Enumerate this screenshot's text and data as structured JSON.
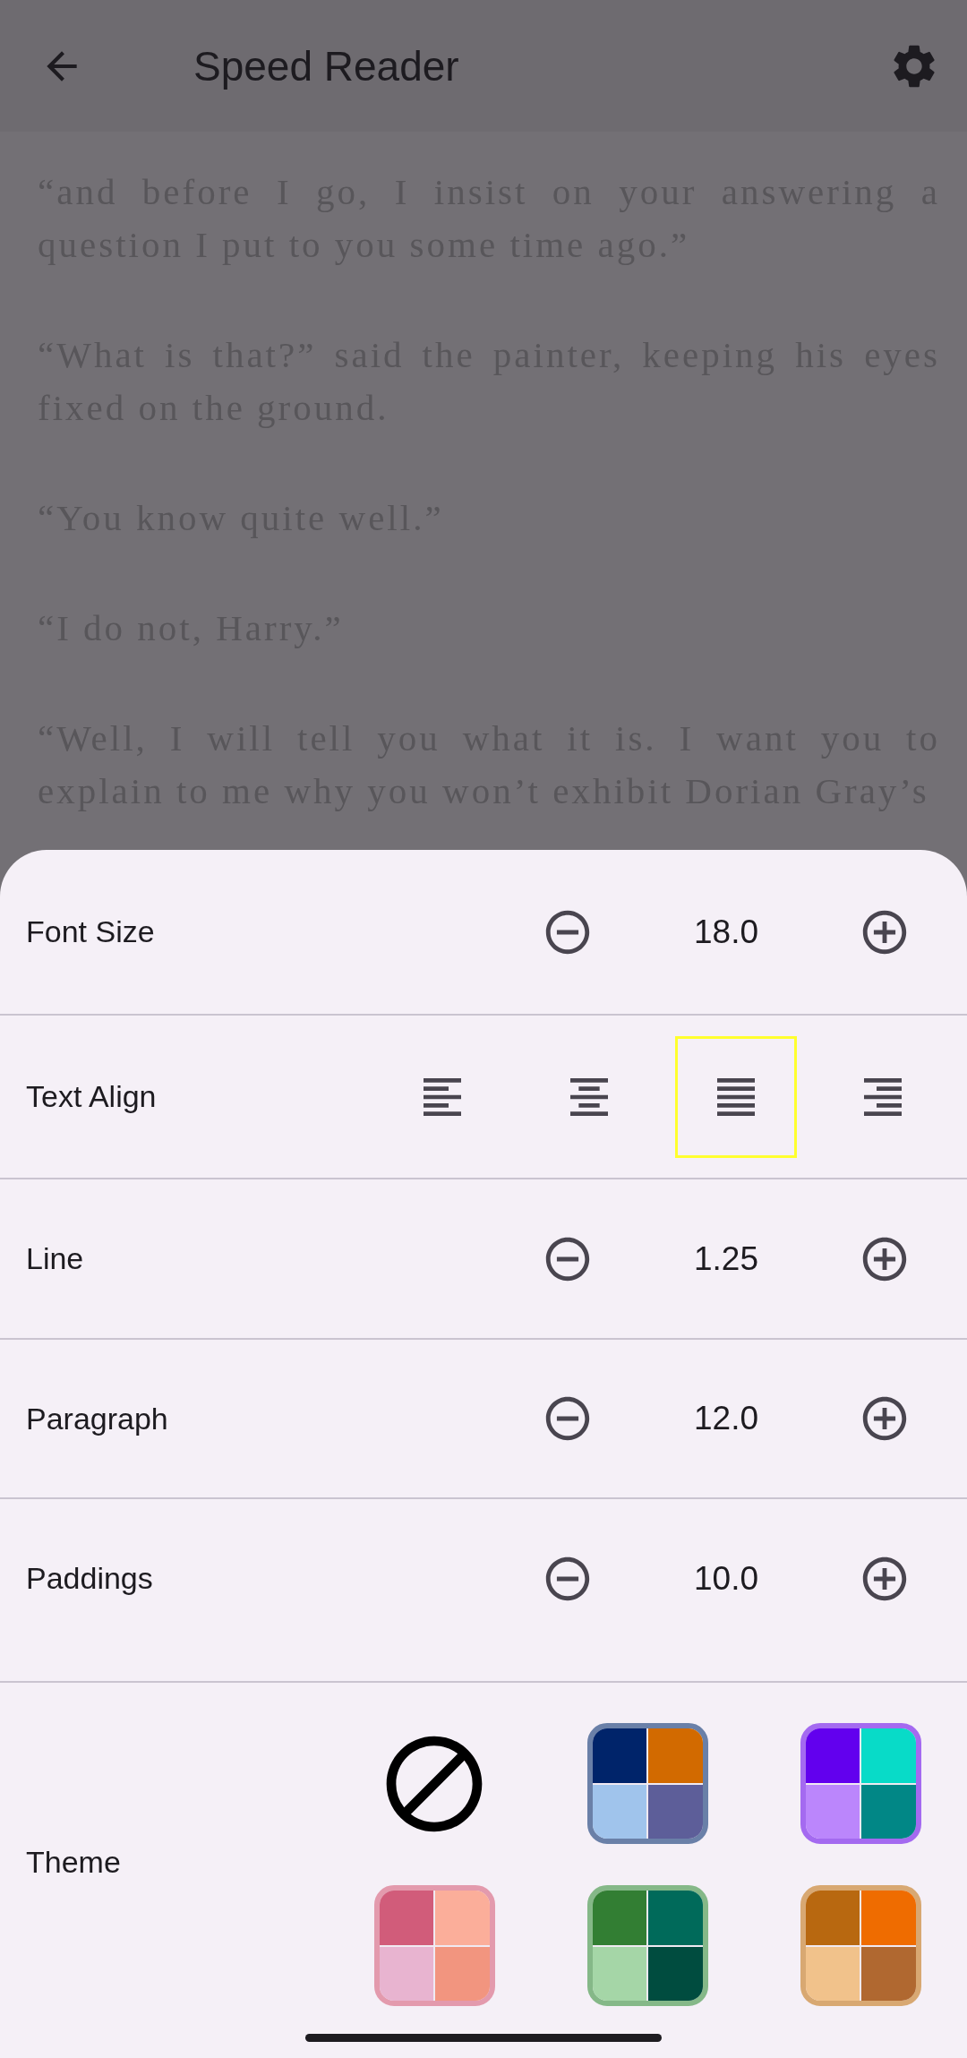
{
  "app_bar": {
    "title": "Speed Reader"
  },
  "reader": {
    "paragraphs": [
      "“and before I go, I insist on your answering a\nquestion I put to you some time ago.”",
      "“What is that?” said the painter, keeping his eyes\nfixed on the ground.",
      "“You know quite well.”",
      "“I do not, Harry.”",
      "“Well, I will tell you what it is. I want you to\nexplain to me why you won’t exhibit Dorian Gray’s"
    ]
  },
  "settings": {
    "rows": [
      {
        "kind": "stepper",
        "label": "Font Size",
        "value": "18.0"
      },
      {
        "kind": "align",
        "label": "Text Align",
        "options": [
          {
            "kind": "left",
            "selected": false
          },
          {
            "kind": "center",
            "selected": false
          },
          {
            "kind": "justify",
            "selected": true
          },
          {
            "kind": "right",
            "selected": false
          }
        ]
      },
      {
        "kind": "stepper",
        "label": "Line",
        "value": "1.25"
      },
      {
        "kind": "stepper",
        "label": "Paragraph",
        "value": "12.0"
      },
      {
        "kind": "stepper",
        "label": "Paddings",
        "value": "10.0"
      }
    ],
    "theme": {
      "label": "Theme",
      "options": [
        {
          "kind": "none"
        },
        {
          "kind": "palette",
          "color": "#6a80a8",
          "quadrants": [
            {
              "color": "#00246a"
            },
            {
              "color": "#d26a00"
            },
            {
              "color": "#a0c4ec"
            },
            {
              "color": "#5d5e99"
            }
          ]
        },
        {
          "kind": "palette",
          "color": "#a46af0",
          "quadrants": [
            {
              "color": "#6200ee"
            },
            {
              "color": "#08dbc8"
            },
            {
              "color": "#bb86fc"
            },
            {
              "color": "#018786"
            }
          ]
        },
        {
          "kind": "palette",
          "color": "#e39aad",
          "quadrants": [
            {
              "color": "#d15c7a"
            },
            {
              "color": "#fbae9a"
            },
            {
              "color": "#e8b4d0"
            },
            {
              "color": "#f2957f"
            }
          ]
        },
        {
          "kind": "palette",
          "color": "#85b888",
          "quadrants": [
            {
              "color": "#327e33"
            },
            {
              "color": "#006a5a"
            },
            {
              "color": "#a5d6a7"
            },
            {
              "color": "#004c3f"
            }
          ]
        },
        {
          "kind": "palette",
          "color": "#d8a872",
          "quadrants": [
            {
              "color": "#b86810"
            },
            {
              "color": "#ef6c00"
            },
            {
              "color": "#f1c28b"
            },
            {
              "color": "#b06830"
            }
          ]
        }
      ]
    }
  }
}
